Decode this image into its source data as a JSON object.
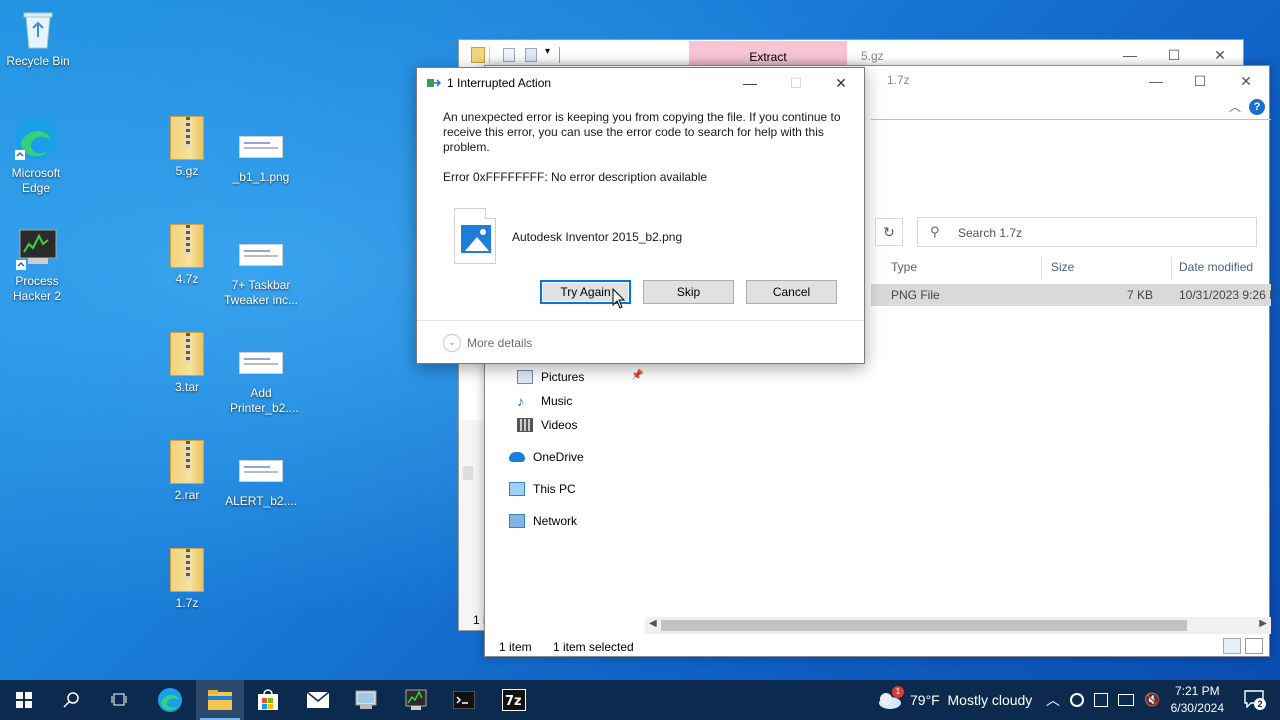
{
  "desktop": {
    "icons": [
      {
        "label": "Recycle Bin",
        "icon": "recycle-bin-icon"
      },
      {
        "label": "Microsoft Edge",
        "icon": "edge-icon"
      },
      {
        "label": "Process Hacker 2",
        "icon": "process-hacker-icon"
      },
      {
        "label": "5.gz",
        "icon": "zip-folder-icon"
      },
      {
        "label": "_b1_1.png",
        "icon": "png-file-icon"
      },
      {
        "label": "4.7z",
        "icon": "zip-folder-icon"
      },
      {
        "label": "7+ Taskbar Tweaker inc...",
        "icon": "png-file-icon"
      },
      {
        "label": "3.tar",
        "icon": "zip-folder-icon"
      },
      {
        "label": "Add Printer_b2....",
        "icon": "png-file-icon"
      },
      {
        "label": "2.rar",
        "icon": "zip-folder-icon"
      },
      {
        "label": "ALERT_b2....",
        "icon": "png-file-icon"
      },
      {
        "label": "1.7z",
        "icon": "zip-folder-icon"
      }
    ]
  },
  "back_window": {
    "ribbon_tab": "Extract",
    "title": "5.gz",
    "status_fragment": "1 i"
  },
  "front_window": {
    "title": "1.7z",
    "search_placeholder": "Search 1.7z",
    "columns": {
      "type": "Type",
      "size": "Size",
      "date": "Date modified"
    },
    "file_row": {
      "type": "PNG File",
      "size": "7 KB",
      "date": "10/31/2023 9:26 P"
    },
    "nav": [
      {
        "label": "Pictures",
        "icon": "pictures-icon"
      },
      {
        "label": "Music",
        "icon": "music-icon"
      },
      {
        "label": "Videos",
        "icon": "videos-icon"
      },
      {
        "label": "OneDrive",
        "icon": "onedrive-icon"
      },
      {
        "label": "This PC",
        "icon": "this-pc-icon"
      },
      {
        "label": "Network",
        "icon": "network-icon"
      }
    ],
    "status": {
      "count": "1 item",
      "selected": "1 item selected"
    }
  },
  "dialog": {
    "title": "1 Interrupted Action",
    "message": "An unexpected error is keeping you from copying the file. If you continue to receive this error, you can use the error code to search for help with this problem.",
    "error": "Error 0xFFFFFFFF: No error description available",
    "file_name": "Autodesk Inventor 2015_b2.png",
    "buttons": {
      "try_again": "Try Again",
      "skip": "Skip",
      "cancel": "Cancel"
    },
    "more_details": "More details"
  },
  "taskbar": {
    "weather": "79°F  Mostly cloudy",
    "weather_badge": "1",
    "time": "7:21 PM",
    "date": "6/30/2024",
    "notification_count": "2",
    "apps": [
      "start-icon",
      "search-icon",
      "task-view-icon",
      "edge-icon",
      "file-explorer-icon",
      "store-icon",
      "mail-icon",
      "archive-tool-icon",
      "process-hacker-icon",
      "terminal-icon",
      "7zip-icon"
    ]
  },
  "colors": {
    "accent": "#0078d7",
    "taskbar": "#0b2a4e",
    "extract_tab": "#f7c4d6",
    "selected_row": "#d9d9d9"
  }
}
